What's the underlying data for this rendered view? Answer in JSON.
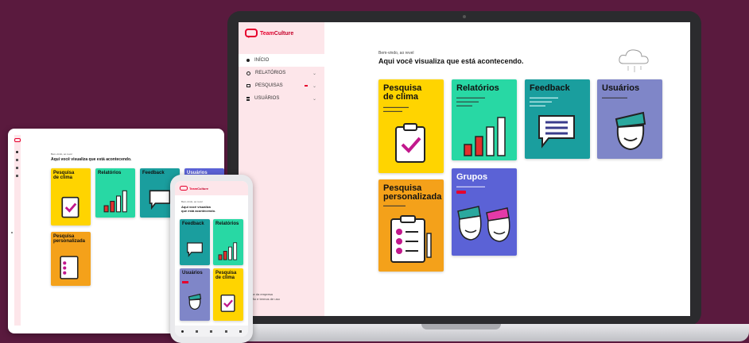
{
  "brand": {
    "name_a": "Team",
    "name_b": "Culture",
    "color": "#e6002d"
  },
  "laptop": {
    "greeting": "Bem-vindo, ao revel",
    "subtitle": "Aqui você visualiza que está acontecendo.",
    "menu": [
      {
        "label": "INÍCIO",
        "icon": "home-icon"
      },
      {
        "label": "RELATÓRIOS",
        "icon": "reports-icon"
      },
      {
        "label": "PESQUISAS",
        "icon": "surveys-icon"
      },
      {
        "label": "USUÁRIOS",
        "icon": "users-icon"
      }
    ],
    "footer_line1": "Nome da empresa",
    "footer_line2": "versão e termos de uso"
  },
  "cards": [
    {
      "title": "Pesquisa\nde clima",
      "color": "#ffd400",
      "icon": "clipboard-check-icon"
    },
    {
      "title": "Relatórios",
      "color": "#28d8a4",
      "icon": "bar-chart-icon"
    },
    {
      "title": "Feedback",
      "color": "#1a9e9e",
      "icon": "chat-bubble-icon"
    },
    {
      "title": "Usuários",
      "color": "#7f86c8",
      "icon": "user-face-icon"
    },
    {
      "title": "Pesquisa\npersonalizada",
      "color": "#f4a11a",
      "icon": "checklist-icon"
    },
    {
      "title": "Grupos",
      "color": "#5b62d6",
      "icon": "group-faces-icon"
    }
  ],
  "tablet": {
    "greeting": "Bem-vindo, ao revel",
    "subtitle": "Aqui você visualiza que está acontecendo.",
    "cards": [
      "Pesquisa\nde clima",
      "Relatórios",
      "Feedback",
      "Usuários",
      "Pesquisa\npersonalizada"
    ]
  },
  "phone": {
    "greeting": "Bem-vindo, ao revel",
    "subtitle": "Aqui você visualiza\nque está acontecendo.",
    "cards": [
      "Feedback",
      "Relatórios",
      "Usuários",
      "Pesquisa\nde clima"
    ]
  },
  "colors": {
    "background": "#5a1a3e",
    "sidebar": "#fde6ea",
    "accent": "#e6002d"
  }
}
